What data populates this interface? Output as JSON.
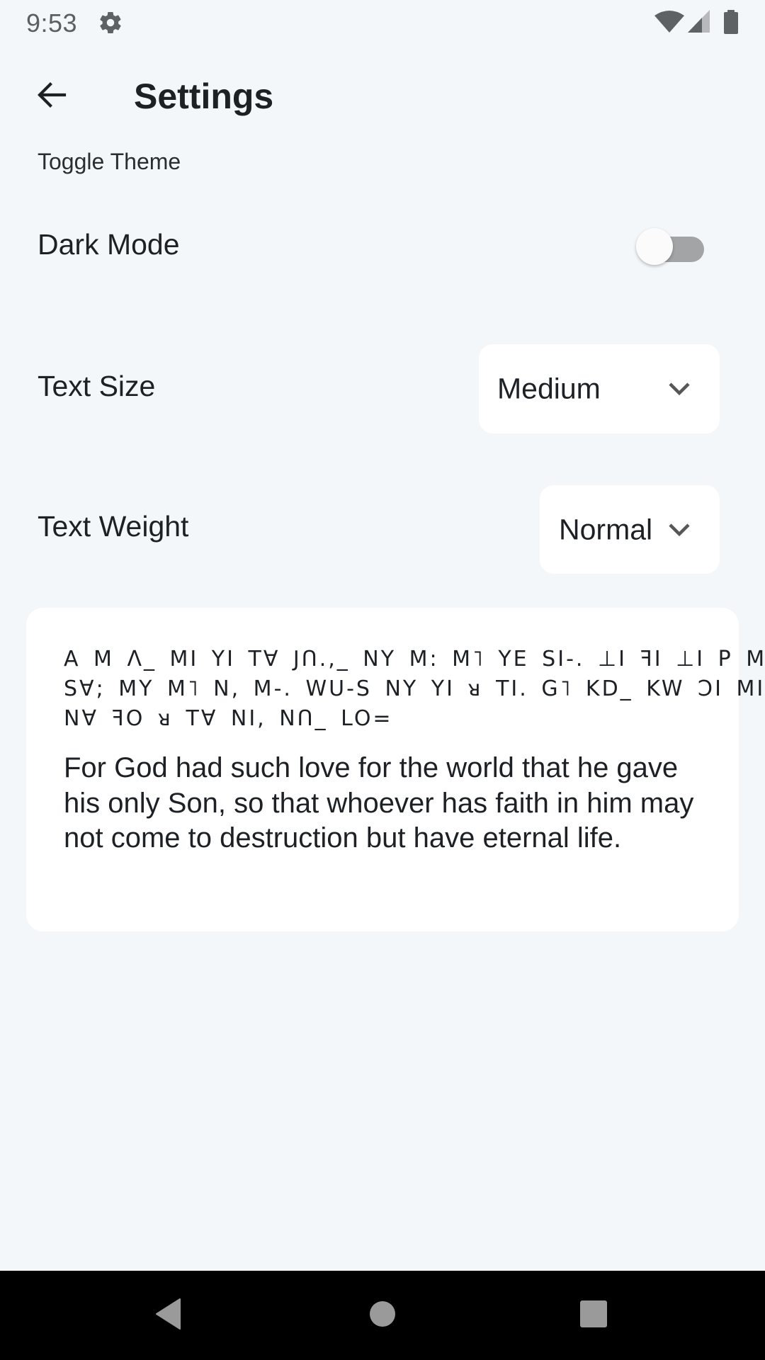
{
  "status_bar": {
    "time": "9:53",
    "icons": [
      "gear-icon",
      "wifi-icon",
      "cellular-signal-icon",
      "battery-icon"
    ]
  },
  "app_bar": {
    "back_icon": "arrow-left-icon",
    "title": "Settings"
  },
  "settings": {
    "section_label": "Toggle Theme",
    "dark_mode": {
      "label": "Dark Mode",
      "enabled": false
    },
    "text_size": {
      "label": "Text Size",
      "selected": "Medium",
      "icon": "chevron-down-icon"
    },
    "text_weight": {
      "label": "Text Weight",
      "selected": "Normal",
      "icon": "chevron-down-icon"
    }
  },
  "preview": {
    "script_lines": [
      "A M Λ_ MI YI TⱯ JՈ.,_ NY M: M˥ YE SI-. ⊥I ꟻI ⊥I P M",
      "SⱯ; MY M˥ N, M-. WU-S NY YI ᴚ TI. G˥ KD_ KW ƆI MI",
      "NⱯ ꟻO ᴚ TⱯ NI, NՈ_ LO="
    ],
    "verse": " For God had such love for the world that he gave his only Son, so that whoever has faith in him may not come to destruction but have eternal life."
  },
  "nav_bar": {
    "buttons": [
      "back-triangle-icon",
      "home-circle-icon",
      "recents-square-icon"
    ]
  },
  "colors": {
    "background": "#f3f7fa",
    "surface": "#ffffff",
    "text": "#1d2024",
    "toggle_track_off": "#a2a4a6",
    "nav_bar": "#000000",
    "nav_icons": "#9a9a9a"
  }
}
